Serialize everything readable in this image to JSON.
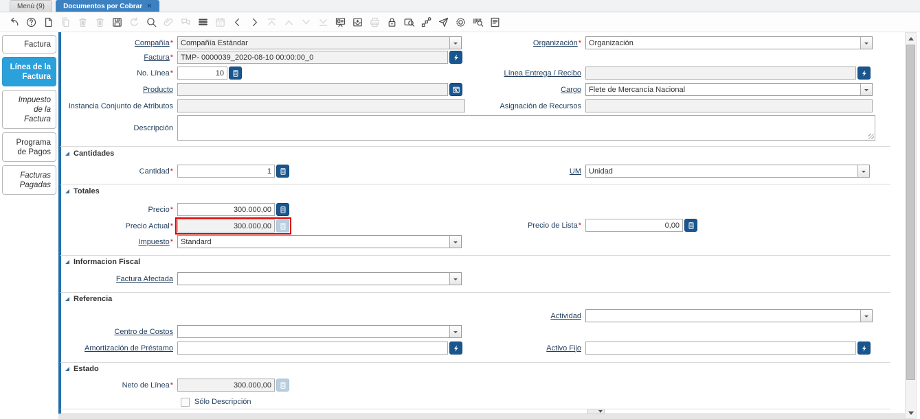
{
  "app_tabs": [
    {
      "label": "Menú (9)",
      "active": false
    },
    {
      "label": "Documentos por Cobrar",
      "active": true
    }
  ],
  "ui": {
    "required_mark": "*",
    "close_mark": "×"
  },
  "toolbar": {
    "items": [
      {
        "name": "undo",
        "disabled": false
      },
      {
        "name": "help",
        "disabled": false
      },
      {
        "name": "new-record",
        "disabled": false
      },
      {
        "name": "copy-record",
        "disabled": true
      },
      {
        "name": "delete-record",
        "disabled": true
      },
      {
        "name": "delete-selection",
        "disabled": true
      },
      {
        "name": "save",
        "disabled": false
      },
      {
        "name": "refresh",
        "disabled": true
      },
      {
        "name": "find",
        "disabled": false
      },
      {
        "name": "attachment",
        "disabled": true
      },
      {
        "name": "chat",
        "disabled": true
      },
      {
        "name": "toggle-grid",
        "disabled": false
      },
      {
        "name": "calendar",
        "disabled": true
      },
      {
        "name": "prev-record",
        "disabled": false
      },
      {
        "name": "next-record",
        "disabled": false
      },
      {
        "name": "first-record",
        "disabled": true
      },
      {
        "name": "up-record",
        "disabled": true
      },
      {
        "name": "down-record",
        "disabled": true
      },
      {
        "name": "last-record",
        "disabled": true
      },
      {
        "name": "detail-panel",
        "disabled": false
      },
      {
        "name": "archive",
        "disabled": false
      },
      {
        "name": "print",
        "disabled": true
      },
      {
        "name": "lock",
        "disabled": false
      },
      {
        "name": "zoom-across",
        "disabled": false
      },
      {
        "name": "workflow",
        "disabled": false
      },
      {
        "name": "request",
        "disabled": false
      },
      {
        "name": "preferences",
        "disabled": false
      },
      {
        "name": "product-info",
        "disabled": false
      },
      {
        "name": "report",
        "disabled": false
      }
    ]
  },
  "sidebar": {
    "tabs": [
      {
        "label": "Factura",
        "active": false,
        "italic": false
      },
      {
        "label": "Línea de la Factura",
        "active": true,
        "italic": false
      },
      {
        "label": "Impuesto de la Factura",
        "active": false,
        "italic": true
      },
      {
        "label": "Programa de Pagos",
        "active": false,
        "italic": false
      },
      {
        "label": "Facturas Pagadas",
        "active": false,
        "italic": true
      }
    ]
  },
  "sections": {
    "cantidades": "Cantidades",
    "totales": "Totales",
    "informacion_fiscal": "Informacion Fiscal",
    "referencia": "Referencia",
    "estado": "Estado"
  },
  "form": {
    "compania": {
      "label": "Compañía",
      "required": true,
      "value": "Compañía Estándar"
    },
    "organizacion": {
      "label": "Organización",
      "required": true,
      "value": "Organización"
    },
    "factura": {
      "label": "Factura",
      "required": true,
      "value": "TMP- 0000039_2020-08-10 00:00:00_0"
    },
    "no_linea": {
      "label": "No. Línea",
      "required": true,
      "value": "10"
    },
    "linea_entrega": {
      "label": "Línea Entrega / Recibo",
      "required": false,
      "value": ""
    },
    "producto": {
      "label": "Producto",
      "required": false,
      "value": ""
    },
    "cargo": {
      "label": "Cargo",
      "required": false,
      "value": "Flete de Mercancía Nacional"
    },
    "instancia": {
      "label": "Instancia Conjunto de Atributos",
      "required": false,
      "value": ""
    },
    "asignacion": {
      "label": "Asignación de Recursos",
      "required": false,
      "value": ""
    },
    "descripcion": {
      "label": "Descripción",
      "required": false,
      "value": ""
    },
    "cantidad": {
      "label": "Cantidad",
      "required": true,
      "value": "1"
    },
    "um": {
      "label": "UM",
      "required": false,
      "value": "Unidad"
    },
    "precio": {
      "label": "Precio",
      "required": true,
      "value": "300.000,00"
    },
    "precio_actual": {
      "label": "Precio Actual",
      "required": true,
      "value": "300.000,00",
      "highlighted": true
    },
    "precio_lista": {
      "label": "Precio de Lista",
      "required": true,
      "value": "0,00"
    },
    "impuesto": {
      "label": "Impuesto",
      "required": true,
      "value": "Standard"
    },
    "factura_afectada": {
      "label": "Factura Afectada",
      "required": false,
      "value": ""
    },
    "actividad": {
      "label": "Actividad",
      "required": false,
      "value": ""
    },
    "centro_costos": {
      "label": "Centro de Costos",
      "required": false,
      "value": ""
    },
    "amortizacion": {
      "label": "Amortización de Préstamo",
      "required": false,
      "value": ""
    },
    "activo_fijo": {
      "label": "Activo Fijo",
      "required": false,
      "value": ""
    },
    "neto_linea": {
      "label": "Neto de Línea",
      "required": true,
      "value": "300.000,00"
    },
    "solo_descripcion": {
      "label": "Sólo Descripción",
      "checked": false
    }
  },
  "colors": {
    "active_tab": "#3c82c3",
    "sidebar_active": "#2ba1dc",
    "accent_bar": "#2170ae",
    "button_blue": "#1a568e",
    "button_blue_disabled": "#b7cede",
    "highlight_red": "#dd0000"
  }
}
